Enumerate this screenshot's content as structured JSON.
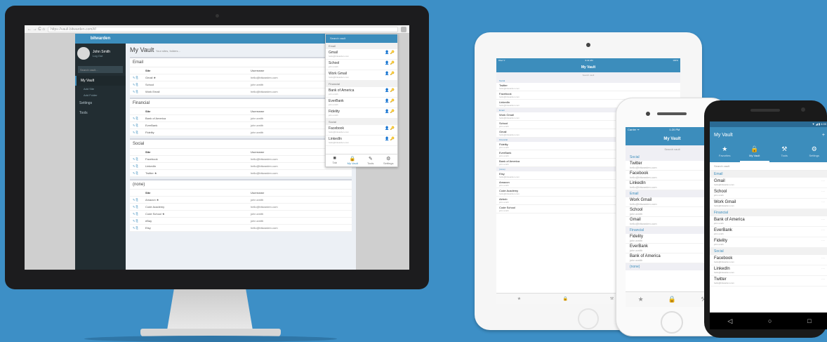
{
  "desktop": {
    "browser": {
      "nav": "← → C ⌂",
      "url": "https://vault.bitwarden.com/#/"
    },
    "brand": "bitwarden",
    "user": {
      "name": "John Smith",
      "action": "Log Out"
    },
    "sidebar": {
      "search_placeholder": "Search vault...",
      "items": [
        {
          "label": "My Vault",
          "icon": "lock-icon"
        },
        {
          "label": "Settings",
          "icon": "gear-icon"
        },
        {
          "label": "Tools",
          "icon": "wrench-icon"
        }
      ],
      "sub_items": [
        "Add Site",
        "Add Folder"
      ]
    },
    "main": {
      "title": "My Vault",
      "subtitle": "Your sites, folders...",
      "col_site": "Site",
      "col_user": "Username",
      "folders": [
        {
          "name": "Email",
          "rows": [
            {
              "site": "Gmail ★",
              "user": "hello@bitwarden.com"
            },
            {
              "site": "School",
              "user": "john.smith"
            },
            {
              "site": "Work Email",
              "user": "hello@bitwarden.com"
            }
          ]
        },
        {
          "name": "Financial",
          "rows": [
            {
              "site": "Bank of America",
              "user": "john.smith"
            },
            {
              "site": "EverBank",
              "user": "john.smith"
            },
            {
              "site": "Fidelity",
              "user": "john.smith"
            }
          ]
        },
        {
          "name": "Social",
          "rows": [
            {
              "site": "Facebook",
              "user": "hello@bitwarden.com"
            },
            {
              "site": "LinkedIn",
              "user": "hello@bitwarden.com"
            },
            {
              "site": "Twitter ★",
              "user": "hello@bitwarden.com"
            }
          ]
        },
        {
          "name": "(none)",
          "rows": [
            {
              "site": "Amazon ★",
              "user": "john.smith"
            },
            {
              "site": "Code Academy",
              "user": "hello@bitwarden.com"
            },
            {
              "site": "Code School ★",
              "user": "john.smith"
            },
            {
              "site": "eBay",
              "user": "john.smith"
            },
            {
              "site": "Etsy",
              "user": "hello@bitwarden.com"
            }
          ]
        }
      ]
    },
    "extension": {
      "search_placeholder": "Search vault",
      "sections": [
        {
          "name": "Email",
          "items": [
            {
              "name": "Gmail",
              "sub": "hello@bitwarden.com"
            },
            {
              "name": "School",
              "sub": "john.smith"
            },
            {
              "name": "Work Gmail",
              "sub": "hello@bitwarden.com"
            }
          ]
        },
        {
          "name": "Financial",
          "items": [
            {
              "name": "Bank of America",
              "sub": "john.smith"
            },
            {
              "name": "EverBank",
              "sub": "john.smith"
            },
            {
              "name": "Fidelity",
              "sub": "john.smith"
            }
          ]
        },
        {
          "name": "Social",
          "items": [
            {
              "name": "Facebook",
              "sub": "hello@bitwarden.com"
            },
            {
              "name": "LinkedIn",
              "sub": "hello@bitwarden.com"
            }
          ]
        }
      ],
      "tabs": [
        {
          "label": "Tab",
          "glyph": "■"
        },
        {
          "label": "My Vault",
          "glyph": "🔒"
        },
        {
          "label": "Tools",
          "glyph": "✎"
        },
        {
          "label": "Settings",
          "glyph": "⚙"
        }
      ]
    }
  },
  "tablet": {
    "status_left": "iPad ᯤ",
    "status_center": "9:41 AM",
    "status_right": "100%",
    "title": "My Vault",
    "search": "Search vault",
    "sections": [
      {
        "name": "Social",
        "rows": [
          {
            "name": "Twitter",
            "sub": "hello@bitwarden.com"
          },
          {
            "name": "Facebook",
            "sub": "hello@bitwarden.com"
          },
          {
            "name": "LinkedIn",
            "sub": "hello@bitwarden.com"
          }
        ]
      },
      {
        "name": "Email",
        "rows": [
          {
            "name": "Work Gmail",
            "sub": "hello@bitwarden.com"
          },
          {
            "name": "School",
            "sub": "john.smith"
          },
          {
            "name": "Gmail",
            "sub": "hello@bitwarden.com"
          }
        ]
      },
      {
        "name": "Financial",
        "rows": [
          {
            "name": "Fidelity",
            "sub": "john.smith"
          },
          {
            "name": "EverBank",
            "sub": "john.smith"
          },
          {
            "name": "Bank of America",
            "sub": "john.smith"
          }
        ]
      },
      {
        "name": "(none)",
        "rows": [
          {
            "name": "Etsy",
            "sub": "hello@bitwarden.com"
          },
          {
            "name": "Amazon",
            "sub": "john.smith"
          },
          {
            "name": "Code Academy",
            "sub": "hello@bitwarden.com"
          },
          {
            "name": "Airbnb",
            "sub": "john.smith"
          },
          {
            "name": "Code School",
            "sub": "john.smith"
          }
        ]
      }
    ]
  },
  "iphone": {
    "status_left": "Carrier ᯤ",
    "status_center": "1:20 PM",
    "status_right": "100%",
    "title": "My Vault",
    "search": "Search vault",
    "sections": [
      {
        "name": "Social",
        "rows": [
          {
            "name": "Twitter",
            "sub": "hello@bitwarden.com"
          },
          {
            "name": "Facebook",
            "sub": "hello@bitwarden.com"
          },
          {
            "name": "LinkedIn",
            "sub": "hello@bitwarden.com"
          }
        ]
      },
      {
        "name": "Email",
        "rows": [
          {
            "name": "Work Gmail",
            "sub": "hello@bitwarden.com"
          },
          {
            "name": "School",
            "sub": "john.smith"
          },
          {
            "name": "Gmail",
            "sub": "hello@bitwarden.com"
          }
        ]
      },
      {
        "name": "Financial",
        "rows": [
          {
            "name": "Fidelity",
            "sub": "john.smith"
          },
          {
            "name": "EverBank",
            "sub": "john.smith"
          },
          {
            "name": "Bank of America",
            "sub": "john.smith"
          }
        ]
      },
      {
        "name": "(none)",
        "rows": []
      }
    ],
    "tabs": [
      "★",
      "🔒",
      "⚒"
    ]
  },
  "android": {
    "status": "▼ ◢ ▮ 4:00",
    "title": "My Vault",
    "add": "+",
    "tabs": [
      {
        "label": "Favorites",
        "glyph": "★"
      },
      {
        "label": "My Vault",
        "glyph": "🔒"
      },
      {
        "label": "Tools",
        "glyph": "⚒"
      },
      {
        "label": "Settings",
        "glyph": "⚙"
      }
    ],
    "search": "Search vault",
    "sections": [
      {
        "name": "Email",
        "rows": [
          {
            "name": "Gmail",
            "sub": "hello@bitwarden.com"
          },
          {
            "name": "School",
            "sub": "john.smith"
          },
          {
            "name": "Work Gmail",
            "sub": "hello@bitwarden.com"
          }
        ]
      },
      {
        "name": "Financial",
        "rows": [
          {
            "name": "Bank of America",
            "sub": "john.smith"
          },
          {
            "name": "EverBank",
            "sub": "john.smith"
          },
          {
            "name": "Fidelity",
            "sub": "john.smith"
          }
        ]
      },
      {
        "name": "Social",
        "rows": [
          {
            "name": "Facebook",
            "sub": "hello@bitwarden.com"
          },
          {
            "name": "LinkedIn",
            "sub": "hello@bitwarden.com"
          },
          {
            "name": "Twitter",
            "sub": "hello@bitwarden.com"
          }
        ]
      }
    ],
    "nav": [
      "◁",
      "○",
      "□"
    ]
  }
}
